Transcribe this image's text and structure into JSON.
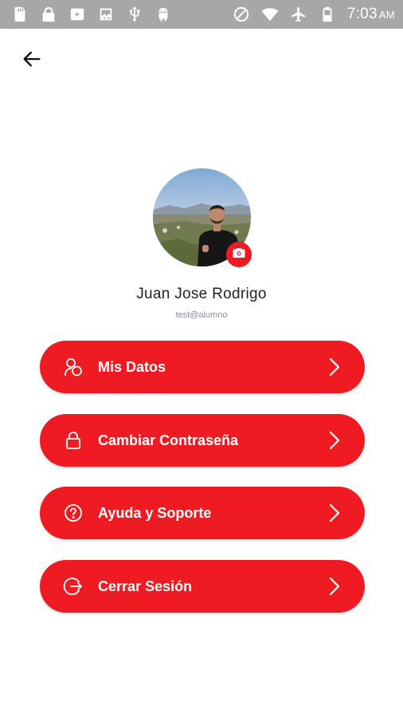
{
  "status_bar": {
    "time": "7:03",
    "ampm": "AM",
    "left_icons": [
      "sd-card-icon",
      "lock-icon",
      "youtube-icon",
      "image-icon",
      "usb-icon",
      "android-icon"
    ],
    "right_icons": [
      "do-not-disturb-icon",
      "wifi-icon",
      "airplane-icon",
      "battery-icon"
    ]
  },
  "header": {
    "back_icon": "arrow-left-icon"
  },
  "profile": {
    "name": "Juan Jose Rodrigo",
    "email": "test@alumno",
    "camera_icon": "camera-icon"
  },
  "menu": {
    "items": [
      {
        "label": "Mis Datos",
        "icon": "people-icon"
      },
      {
        "label": "Cambiar Contraseña",
        "icon": "lock-icon"
      },
      {
        "label": "Ayuda y Soporte",
        "icon": "help-circle-icon"
      },
      {
        "label": "Cerrar Sesión",
        "icon": "logout-icon"
      }
    ],
    "chevron_icon": "chevron-right-icon"
  },
  "colors": {
    "accent": "#f01b22",
    "status_bar": "#a7a7a7",
    "email_text": "#8a8ea6"
  }
}
